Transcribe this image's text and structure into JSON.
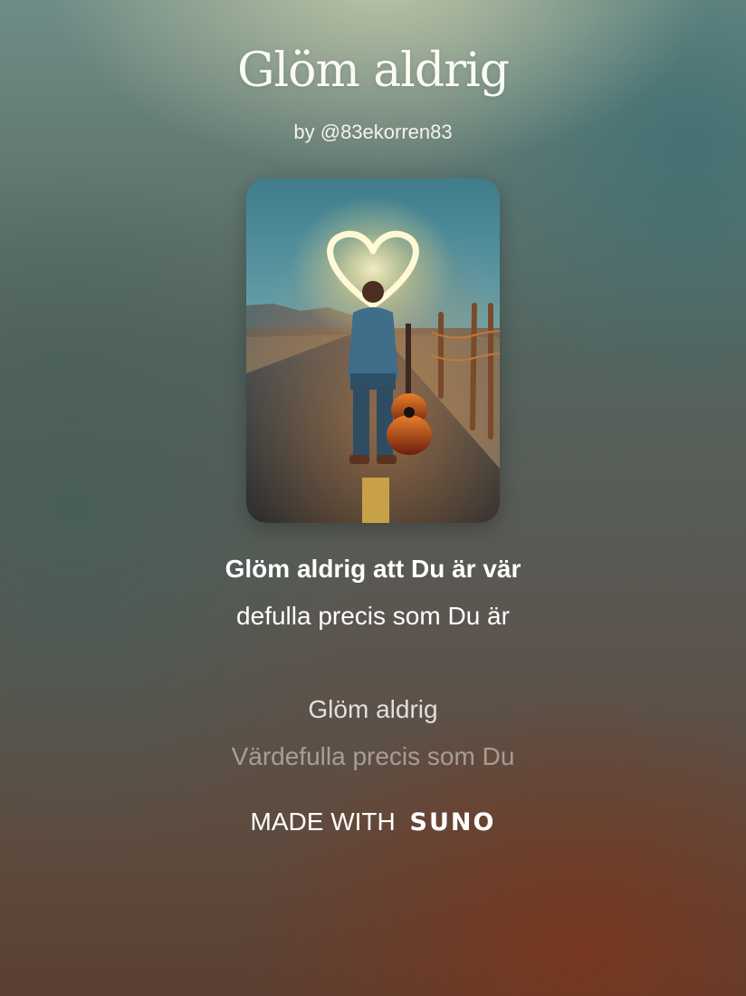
{
  "song": {
    "title": "Glöm aldrig",
    "byline": "by @83ekorren83"
  },
  "cover": {
    "icon": "cover-art-heart-guitar-road"
  },
  "lyrics": {
    "line1": "Glöm aldrig att Du är vär",
    "line2": "defulla precis som Du är",
    "line3": "Glöm aldrig",
    "line4": "Värdefulla precis som Du"
  },
  "footer": {
    "made_with": "MADE WITH",
    "brand": "SUNO"
  }
}
